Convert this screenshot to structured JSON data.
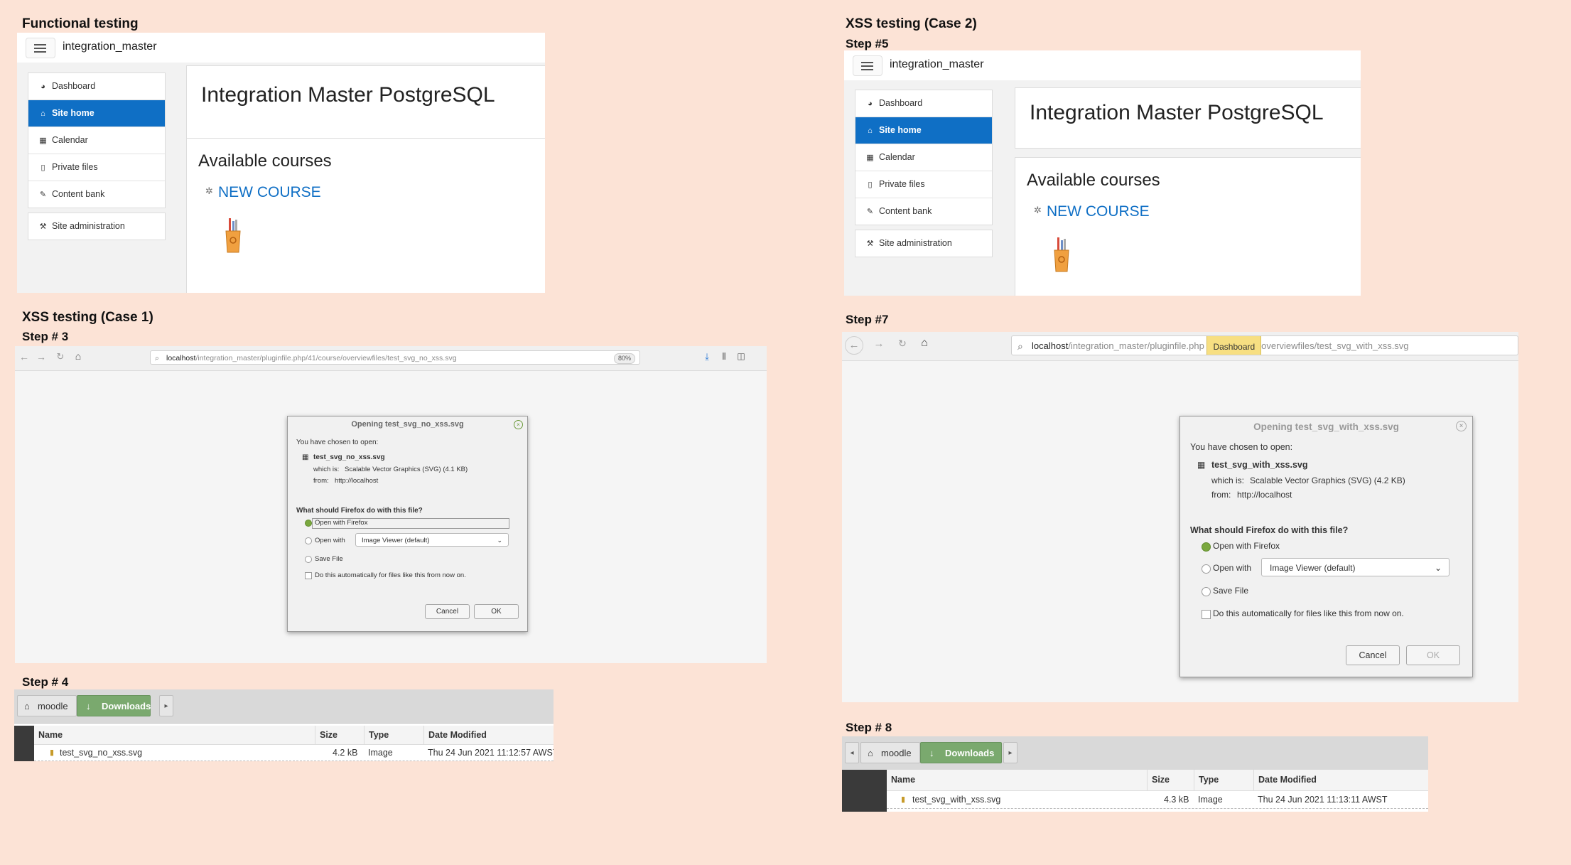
{
  "sections": {
    "functional": "Functional testing",
    "xss_case1": "XSS testing (Case 1)",
    "xss_case2": "XSS testing (Case 2)"
  },
  "steps": {
    "step3": "Step # 3",
    "step4": "Step # 4",
    "step5": "Step #5",
    "step7": "Step #7",
    "step8": "Step # 8"
  },
  "moodle": {
    "site_name": "integration_master",
    "nav_items": [
      "Dashboard",
      "Site home",
      "Calendar",
      "Private files",
      "Content bank"
    ],
    "nav_admin": "Site administration",
    "page_title": "Integration Master PostgreSQL",
    "available_courses": "Available courses",
    "course_name": "NEW COURSE"
  },
  "browser1": {
    "url_host": "localhost",
    "url_path": "/integration_master/pluginfile.php/41/course/overviewfiles/test_svg_no_xss.svg",
    "zoom": "80%",
    "dialog": {
      "title": "Opening test_svg_no_xss.svg",
      "chosen": "You have chosen to open:",
      "filename": "test_svg_no_xss.svg",
      "which_is": "which is:",
      "type": "Scalable Vector Graphics (SVG) (4.1 KB)",
      "from_label": "from:",
      "from": "http://localhost",
      "question": "What should Firefox do with this file?",
      "open_firefox": "Open with Firefox",
      "open_with": "Open with",
      "viewer": "Image Viewer (default)",
      "save_file": "Save File",
      "auto": "Do this automatically for files like this from now on.",
      "cancel": "Cancel",
      "ok": "OK"
    }
  },
  "browser2": {
    "url_host": "localhost",
    "url_path_a": "/integration_master/pluginfile.php",
    "tooltip": "Dashboard",
    "url_path_b": "overviewfiles/test_svg_with_xss.svg",
    "dialog": {
      "title": "Opening test_svg_with_xss.svg",
      "chosen": "You have chosen to open:",
      "filename": "test_svg_with_xss.svg",
      "which_is": "which is:",
      "type": "Scalable Vector Graphics (SVG) (4.2 KB)",
      "from_label": "from:",
      "from": "http://localhost",
      "question": "What should Firefox do with this file?",
      "open_firefox": "Open with Firefox",
      "open_with": "Open with",
      "viewer": "Image Viewer (default)",
      "save_file": "Save File",
      "auto": "Do this automatically for files like this from now on.",
      "cancel": "Cancel",
      "ok": "OK"
    }
  },
  "files1": {
    "crumb_home": "moodle",
    "crumb_current": "Downloads",
    "columns": [
      "Name",
      "Size",
      "Type",
      "Date Modified"
    ],
    "row": {
      "name": "test_svg_no_xss.svg",
      "size": "4.2 kB",
      "type": "Image",
      "date": "Thu 24 Jun 2021 11:12:57 AWST"
    }
  },
  "files2": {
    "crumb_home": "moodle",
    "crumb_current": "Downloads",
    "columns": [
      "Name",
      "Size",
      "Type",
      "Date Modified"
    ],
    "row": {
      "name": "test_svg_with_xss.svg",
      "size": "4.3 kB",
      "type": "Image",
      "date": "Thu 24 Jun 2021 11:13:11 AWST"
    }
  },
  "colors": {
    "background": "#fce3d6",
    "moodle_blue": "#0f6fc5",
    "breadcrumb_green": "#7aa96e",
    "radio_green": "#7aa83e"
  },
  "icons": [
    "hamburger-icon",
    "dashboard-icon",
    "home-icon",
    "calendar-icon",
    "file-icon",
    "brush-icon",
    "wrench-icon",
    "course-icon",
    "pencil-cup-icon",
    "back-icon",
    "forward-icon",
    "reload-icon",
    "home-icon",
    "search-icon",
    "download-icon",
    "library-icon",
    "sidebar-icon",
    "close-icon",
    "svg-file-icon",
    "chevron-down-icon",
    "folder-home-icon",
    "download-arrow-icon",
    "arrow-left-icon",
    "arrow-right-icon"
  ]
}
